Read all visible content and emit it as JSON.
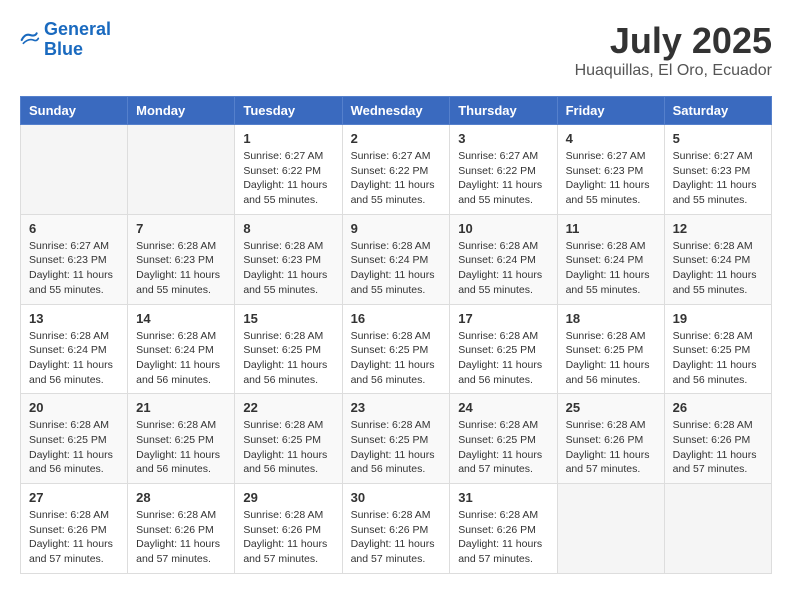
{
  "logo": {
    "line1": "General",
    "line2": "Blue"
  },
  "title": "July 2025",
  "location": "Huaquillas, El Oro, Ecuador",
  "days_header": [
    "Sunday",
    "Monday",
    "Tuesday",
    "Wednesday",
    "Thursday",
    "Friday",
    "Saturday"
  ],
  "weeks": [
    [
      {
        "day": "",
        "info": ""
      },
      {
        "day": "",
        "info": ""
      },
      {
        "day": "1",
        "info": "Sunrise: 6:27 AM\nSunset: 6:22 PM\nDaylight: 11 hours and 55 minutes."
      },
      {
        "day": "2",
        "info": "Sunrise: 6:27 AM\nSunset: 6:22 PM\nDaylight: 11 hours and 55 minutes."
      },
      {
        "day": "3",
        "info": "Sunrise: 6:27 AM\nSunset: 6:22 PM\nDaylight: 11 hours and 55 minutes."
      },
      {
        "day": "4",
        "info": "Sunrise: 6:27 AM\nSunset: 6:23 PM\nDaylight: 11 hours and 55 minutes."
      },
      {
        "day": "5",
        "info": "Sunrise: 6:27 AM\nSunset: 6:23 PM\nDaylight: 11 hours and 55 minutes."
      }
    ],
    [
      {
        "day": "6",
        "info": "Sunrise: 6:27 AM\nSunset: 6:23 PM\nDaylight: 11 hours and 55 minutes."
      },
      {
        "day": "7",
        "info": "Sunrise: 6:28 AM\nSunset: 6:23 PM\nDaylight: 11 hours and 55 minutes."
      },
      {
        "day": "8",
        "info": "Sunrise: 6:28 AM\nSunset: 6:23 PM\nDaylight: 11 hours and 55 minutes."
      },
      {
        "day": "9",
        "info": "Sunrise: 6:28 AM\nSunset: 6:24 PM\nDaylight: 11 hours and 55 minutes."
      },
      {
        "day": "10",
        "info": "Sunrise: 6:28 AM\nSunset: 6:24 PM\nDaylight: 11 hours and 55 minutes."
      },
      {
        "day": "11",
        "info": "Sunrise: 6:28 AM\nSunset: 6:24 PM\nDaylight: 11 hours and 55 minutes."
      },
      {
        "day": "12",
        "info": "Sunrise: 6:28 AM\nSunset: 6:24 PM\nDaylight: 11 hours and 55 minutes."
      }
    ],
    [
      {
        "day": "13",
        "info": "Sunrise: 6:28 AM\nSunset: 6:24 PM\nDaylight: 11 hours and 56 minutes."
      },
      {
        "day": "14",
        "info": "Sunrise: 6:28 AM\nSunset: 6:24 PM\nDaylight: 11 hours and 56 minutes."
      },
      {
        "day": "15",
        "info": "Sunrise: 6:28 AM\nSunset: 6:25 PM\nDaylight: 11 hours and 56 minutes."
      },
      {
        "day": "16",
        "info": "Sunrise: 6:28 AM\nSunset: 6:25 PM\nDaylight: 11 hours and 56 minutes."
      },
      {
        "day": "17",
        "info": "Sunrise: 6:28 AM\nSunset: 6:25 PM\nDaylight: 11 hours and 56 minutes."
      },
      {
        "day": "18",
        "info": "Sunrise: 6:28 AM\nSunset: 6:25 PM\nDaylight: 11 hours and 56 minutes."
      },
      {
        "day": "19",
        "info": "Sunrise: 6:28 AM\nSunset: 6:25 PM\nDaylight: 11 hours and 56 minutes."
      }
    ],
    [
      {
        "day": "20",
        "info": "Sunrise: 6:28 AM\nSunset: 6:25 PM\nDaylight: 11 hours and 56 minutes."
      },
      {
        "day": "21",
        "info": "Sunrise: 6:28 AM\nSunset: 6:25 PM\nDaylight: 11 hours and 56 minutes."
      },
      {
        "day": "22",
        "info": "Sunrise: 6:28 AM\nSunset: 6:25 PM\nDaylight: 11 hours and 56 minutes."
      },
      {
        "day": "23",
        "info": "Sunrise: 6:28 AM\nSunset: 6:25 PM\nDaylight: 11 hours and 56 minutes."
      },
      {
        "day": "24",
        "info": "Sunrise: 6:28 AM\nSunset: 6:25 PM\nDaylight: 11 hours and 57 minutes."
      },
      {
        "day": "25",
        "info": "Sunrise: 6:28 AM\nSunset: 6:26 PM\nDaylight: 11 hours and 57 minutes."
      },
      {
        "day": "26",
        "info": "Sunrise: 6:28 AM\nSunset: 6:26 PM\nDaylight: 11 hours and 57 minutes."
      }
    ],
    [
      {
        "day": "27",
        "info": "Sunrise: 6:28 AM\nSunset: 6:26 PM\nDaylight: 11 hours and 57 minutes."
      },
      {
        "day": "28",
        "info": "Sunrise: 6:28 AM\nSunset: 6:26 PM\nDaylight: 11 hours and 57 minutes."
      },
      {
        "day": "29",
        "info": "Sunrise: 6:28 AM\nSunset: 6:26 PM\nDaylight: 11 hours and 57 minutes."
      },
      {
        "day": "30",
        "info": "Sunrise: 6:28 AM\nSunset: 6:26 PM\nDaylight: 11 hours and 57 minutes."
      },
      {
        "day": "31",
        "info": "Sunrise: 6:28 AM\nSunset: 6:26 PM\nDaylight: 11 hours and 57 minutes."
      },
      {
        "day": "",
        "info": ""
      },
      {
        "day": "",
        "info": ""
      }
    ]
  ]
}
